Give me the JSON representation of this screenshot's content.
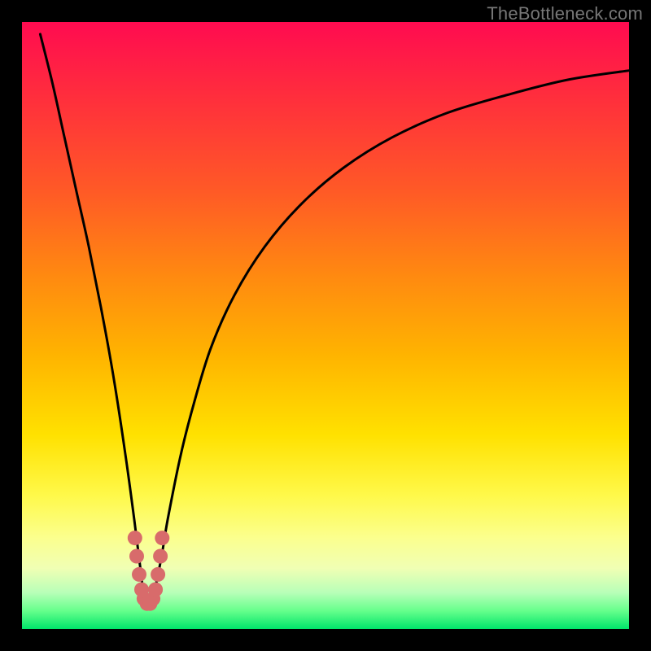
{
  "watermark": "TheBottleneck.com",
  "chart_data": {
    "type": "line",
    "title": "",
    "xlabel": "",
    "ylabel": "",
    "xlim": [
      0,
      100
    ],
    "ylim": [
      0,
      100
    ],
    "series": [
      {
        "name": "bottleneck-curve",
        "x": [
          3,
          5,
          7,
          9,
          11,
          13,
          15,
          17,
          18.5,
          19.5,
          20,
          20.5,
          21,
          21.5,
          22,
          23,
          24,
          26,
          28,
          31,
          35,
          40,
          46,
          53,
          61,
          70,
          80,
          90,
          100
        ],
        "y": [
          98,
          90,
          81,
          72,
          63,
          53,
          42,
          29,
          18,
          10,
          6,
          4,
          4,
          5,
          7,
          12,
          18,
          28,
          36,
          46,
          55,
          63,
          70,
          76,
          81,
          85,
          88,
          90.5,
          92
        ]
      }
    ],
    "markers": {
      "name": "highlight-dots",
      "color": "#d86b6b",
      "points": [
        {
          "x": 18.6,
          "y": 15.0
        },
        {
          "x": 18.9,
          "y": 12.0
        },
        {
          "x": 19.3,
          "y": 9.0
        },
        {
          "x": 19.7,
          "y": 6.5
        },
        {
          "x": 20.1,
          "y": 5.0
        },
        {
          "x": 20.6,
          "y": 4.2
        },
        {
          "x": 21.1,
          "y": 4.2
        },
        {
          "x": 21.6,
          "y": 5.0
        },
        {
          "x": 22.0,
          "y": 6.5
        },
        {
          "x": 22.4,
          "y": 9.0
        },
        {
          "x": 22.8,
          "y": 12.0
        },
        {
          "x": 23.1,
          "y": 15.0
        }
      ]
    }
  }
}
